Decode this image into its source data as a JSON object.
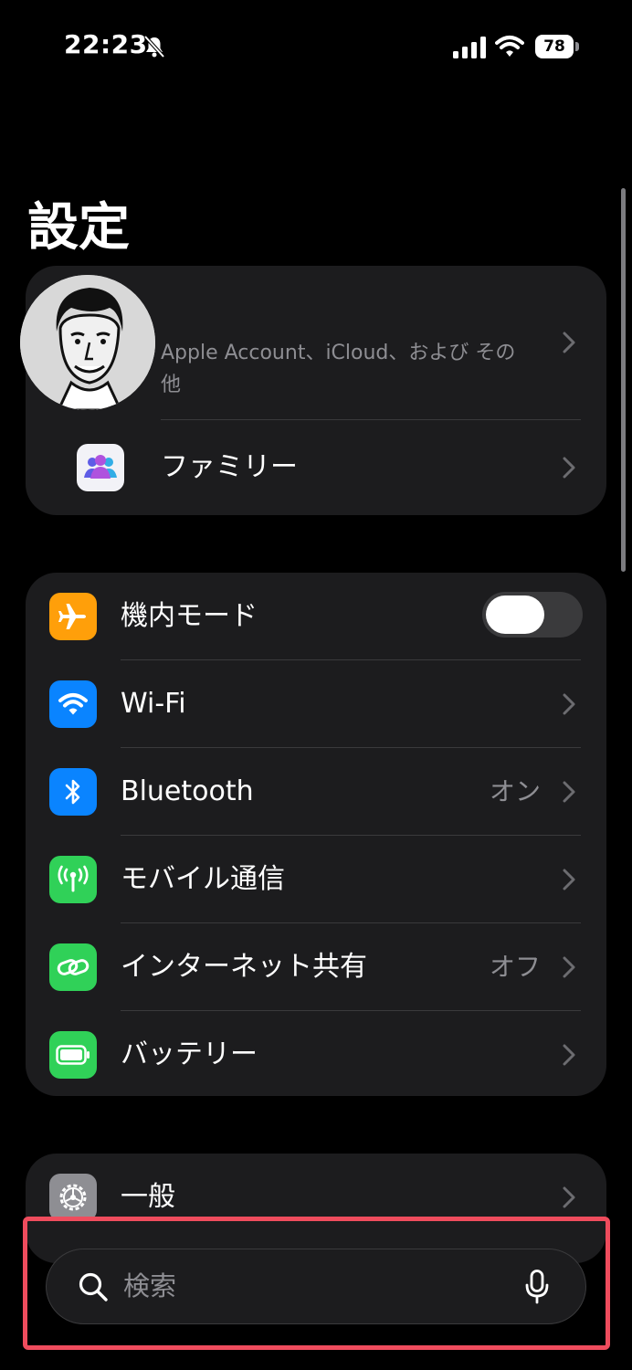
{
  "status_bar": {
    "time": "22:23",
    "battery": "78"
  },
  "title": "設定",
  "profile": {
    "subtitle": "Apple Account、iCloud、および その他"
  },
  "family": {
    "label": "ファミリー"
  },
  "network": [
    {
      "label": "機内モード",
      "icon": "airplane-icon",
      "color": "#ff9f0a"
    },
    {
      "label": "Wi-Fi",
      "icon": "wifi-icon",
      "color": "#0a84ff"
    },
    {
      "label": "Bluetooth",
      "value": "オン",
      "icon": "bluetooth-icon",
      "color": "#0a84ff"
    },
    {
      "label": "モバイル通信",
      "icon": "antenna-icon",
      "color": "#30d158"
    },
    {
      "label": "インターネット共有",
      "value": "オフ",
      "icon": "link-icon",
      "color": "#30d158"
    },
    {
      "label": "バッテリー",
      "icon": "battery-icon",
      "color": "#30d158"
    }
  ],
  "general": {
    "label": "一般"
  },
  "search": {
    "placeholder": "検索"
  },
  "colors": {
    "highlight": "#ef4c5d",
    "group_bg": "#1c1c1e"
  }
}
